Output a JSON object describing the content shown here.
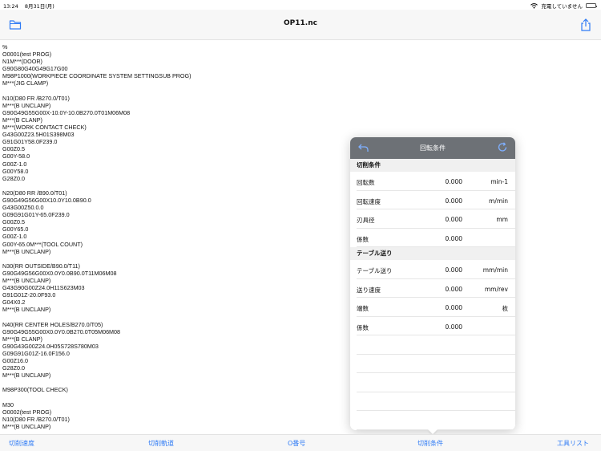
{
  "status": {
    "time": "13:24",
    "date": "8月31日(月)",
    "charging": "充電していません"
  },
  "navbar": {
    "title": "OP11.nc"
  },
  "program_lines": [
    "%",
    "O0001(test PROG)",
    "N1M***(DOOR)",
    "G90G80G40G49G17G00",
    "M98P1000(WORKPIECE COORDINATE SYSTEM SETTINGSUB PROG)",
    "M***(JIG CLAMP)",
    "",
    "N10(D80 FR /B270.0/T01)",
    "M***(B UNCLANP)",
    "G90G49G55G00X-10.0Y-10.0B270.0T01M06M08",
    "M***(B CLANP)",
    "M***(WORK CONTACT CHECK)",
    "G43G00Z23.5H01S398M03",
    "G91G01Y58.0F239.0",
    "G00Z0.5",
    "G00Y-58.0",
    "G00Z-1.0",
    "G00Y58.0",
    "G28Z0.0",
    "",
    "N20(D80 RR /B90.0/T01)",
    "G90G49G56G00X10.0Y10.0B90.0",
    "G43G00Z50.0.0",
    "G09G91G01Y-65.0F239.0",
    "G00Z0.5",
    "G00Y65.0",
    "G00Z-1.0",
    "G00Y-65.0M***(TOOL COUNT)",
    "M***(B UNCLANP)",
    "",
    "N30(RR OUTSIDE/B90.0/T11)",
    "G90G49G56G00X0.0Y0.0B90.0T11M06M08",
    "M***(B UNCLANP)",
    "G43G90G00Z24.0H11S623M03",
    "G91G01Z-20.0F93.0",
    "G04X0.2",
    "M***(B UNCLANP)",
    "",
    "N40(RR CENTER HOLES/B270.0/T05)",
    "G90G49G55G00X0.0Y0.0B270.0T05M06M08",
    "M***(B CLANP)",
    "G90G43G00Z24.0H05S728S780M03",
    "G09G91G01Z-16.0F156.0",
    "G00Z16.0",
    "G28Z0.0",
    "M***(B UNCLANP)",
    "",
    "M98P300(TOOL CHECK)",
    "",
    "M30",
    "O0002(test PROG)",
    "N10(D80 FR /B270.0/T01)",
    "M***(B UNCLANP)"
  ],
  "popup": {
    "title": "回転条件",
    "sections": [
      {
        "header": "切削条件",
        "rows": [
          {
            "label": "回転数",
            "value": "0.000",
            "unit": "min-1"
          },
          {
            "label": "回転速度",
            "value": "0.000",
            "unit": "m/min"
          },
          {
            "label": "刃具径",
            "value": "0.000",
            "unit": "mm"
          },
          {
            "label": "係数",
            "value": "0.000",
            "unit": ""
          }
        ]
      },
      {
        "header": "テーブル送り",
        "rows": [
          {
            "label": "テーブル送り",
            "value": "0.000",
            "unit": "mm/min"
          },
          {
            "label": "送り速度",
            "value": "0.000",
            "unit": "mm/rev"
          },
          {
            "label": "端数",
            "value": "0.000",
            "unit": "枚"
          },
          {
            "label": "係数",
            "value": "0.000",
            "unit": ""
          }
        ]
      }
    ]
  },
  "tabbar": {
    "tabs": [
      {
        "label": "切削速度"
      },
      {
        "label": "切削軌道"
      },
      {
        "label": "O番号"
      },
      {
        "label": "切削条件"
      },
      {
        "label": "工具リスト"
      }
    ]
  },
  "colors": {
    "accent": "#2f7bf5",
    "popup_header": "#6d7176"
  }
}
